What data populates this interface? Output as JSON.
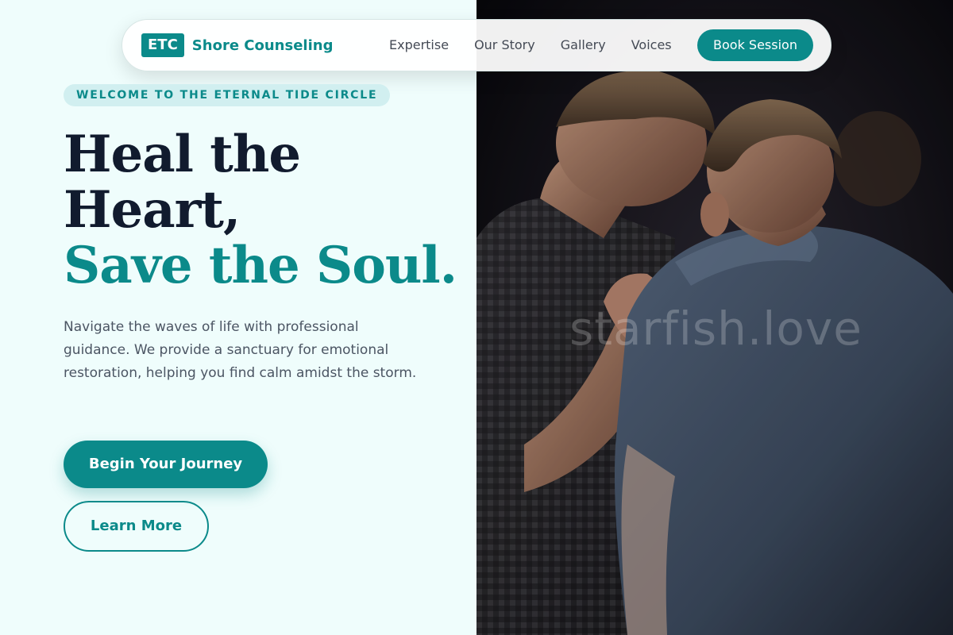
{
  "brand": {
    "badge": "ETC",
    "name": "Shore Counseling"
  },
  "nav": {
    "links": [
      "Expertise",
      "Our Story",
      "Gallery",
      "Voices"
    ],
    "cta_label": "Book Session"
  },
  "hero": {
    "eyebrow": "WELCOME TO THE ETERNAL TIDE CIRCLE",
    "headline_line1": "Heal the",
    "headline_line2": "Heart,",
    "headline_accent": "Save the Soul.",
    "intro": "Navigate the waves of life with professional guidance. We provide a sanctuary for emotional restoration, helping you find calm amidst the storm.",
    "primary_button": "Begin Your Journey",
    "secondary_button": "Learn More"
  },
  "photo": {
    "subject": "two-men-praying-photo",
    "watermark": "starfish.love"
  },
  "colors": {
    "accent": "#0b8a8a",
    "heading": "#111b2e",
    "background": "#effdfc",
    "body_text": "#4b5563"
  }
}
